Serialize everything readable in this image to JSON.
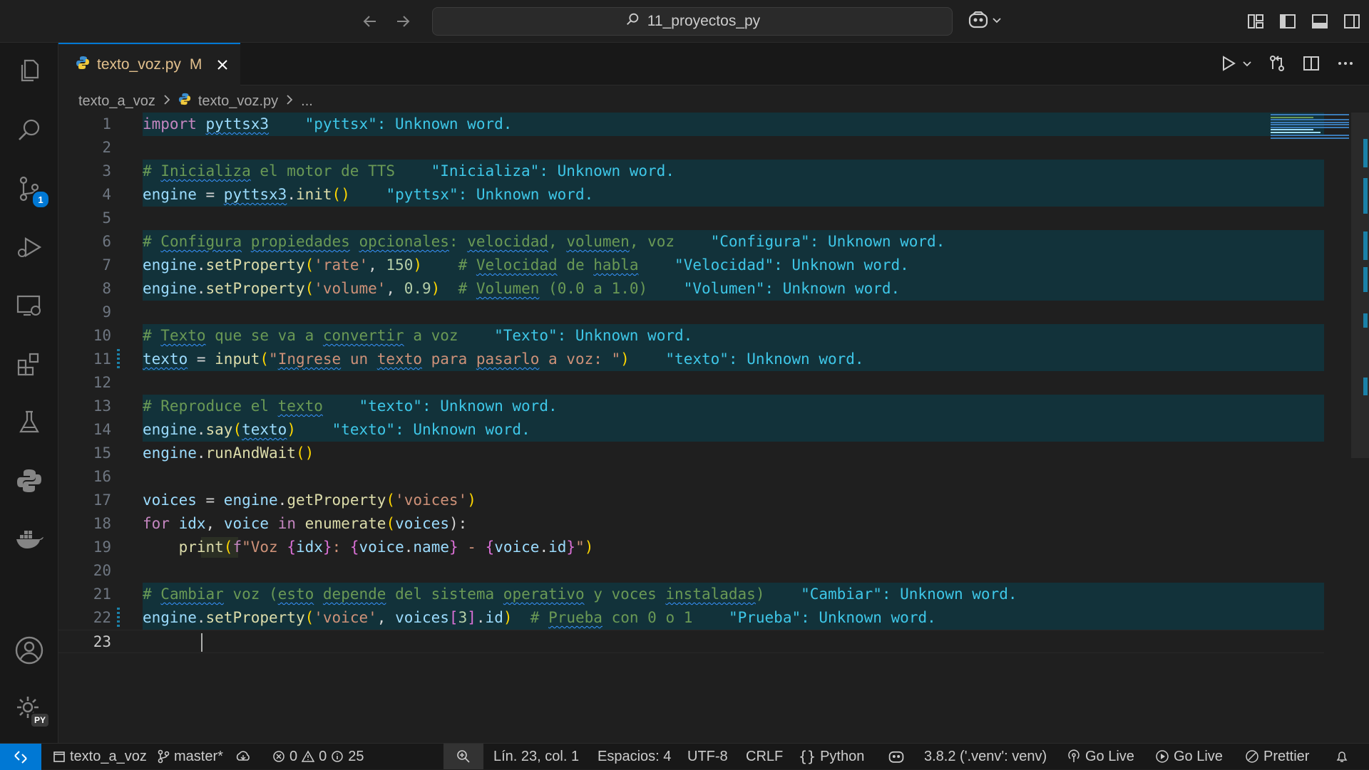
{
  "titlebar": {
    "search_text": "11_proyectos_py"
  },
  "tab": {
    "filename": "texto_voz.py",
    "modified": "M"
  },
  "breadcrumb": {
    "folder": "texto_a_voz",
    "file": "texto_voz.py",
    "more": "..."
  },
  "activity_bar": {
    "scm_badge": "1",
    "account_badge": "PY"
  },
  "status_bar": {
    "folder": "texto_a_voz",
    "branch": "master*",
    "errors": "0",
    "warnings": "0",
    "infos": "25",
    "position": "Lín. 23, col. 1",
    "spaces": "Espacios: 4",
    "encoding": "UTF-8",
    "eol": "CRLF",
    "language": "Python",
    "interpreter": "3.8.2 ('.venv': venv)",
    "go_live_1": "Go Live",
    "go_live_2": "Go Live",
    "prettier": "Prettier"
  },
  "editor": {
    "active_line": "23",
    "line_numbers": [
      "1",
      "2",
      "3",
      "4",
      "5",
      "6",
      "7",
      "8",
      "9",
      "10",
      "11",
      "12",
      "13",
      "14",
      "15",
      "16",
      "17",
      "18",
      "19",
      "20",
      "21",
      "22",
      "23"
    ],
    "tokens": {
      "l1": [
        "import",
        "pyttsx3"
      ],
      "d1": "\"pyttsx\": Unknown word.",
      "l3": [
        "# ",
        "Inicializa",
        " el motor de TTS"
      ],
      "d3": "\"Inicializa\": Unknown word.",
      "l4": [
        "engine",
        " = ",
        "pyttsx3",
        ".",
        "init",
        "(",
        ")"
      ],
      "d4": "\"pyttsx\": Unknown word.",
      "l6": [
        "# ",
        "Configura",
        " ",
        "propiedades",
        " ",
        "opcionales",
        ": ",
        "velocidad",
        ", ",
        "volumen",
        ", voz"
      ],
      "d6": "\"Configura\": Unknown word.",
      "l7": [
        "engine",
        ".",
        "setProperty",
        "(",
        "'rate'",
        ", ",
        "150",
        ")",
        "    ",
        "# ",
        "Velocidad",
        " de ",
        "habla"
      ],
      "d7": "\"Velocidad\": Unknown word.",
      "l8": [
        "engine",
        ".",
        "setProperty",
        "(",
        "'volume'",
        ", ",
        "0.9",
        ")",
        "  ",
        "# ",
        "Volumen",
        " (0.0 a 1.0)"
      ],
      "d8": "\"Volumen\": Unknown word.",
      "l10": [
        "# ",
        "Texto",
        " que se va a ",
        "convertir",
        " a voz"
      ],
      "d10": "\"Texto\": Unknown word.",
      "l11": [
        "texto",
        " = ",
        "input",
        "(",
        "\"",
        "Ingrese",
        " un ",
        "texto",
        " para ",
        "pasarlo",
        " a voz: \"",
        ")"
      ],
      "d11": "\"texto\": Unknown word.",
      "l13": [
        "# Reproduce el ",
        "texto"
      ],
      "d13": "\"texto\": Unknown word.",
      "l14": [
        "engine",
        ".",
        "say",
        "(",
        "texto",
        ")"
      ],
      "d14": "\"texto\": Unknown word.",
      "l15": [
        "engine",
        ".",
        "runAndWait",
        "(",
        ")"
      ],
      "l17": [
        "voices",
        " = ",
        "engine",
        ".",
        "getProperty",
        "(",
        "'voices'",
        ")"
      ],
      "l18": [
        "for",
        " ",
        "idx",
        ", ",
        "voice",
        " ",
        "in",
        " ",
        "enumerate",
        "(",
        "voices",
        "):"
      ],
      "l19": [
        "print",
        "(",
        "f",
        "\"Voz ",
        "{",
        "idx",
        "}",
        ": ",
        "{",
        "voice",
        ".",
        "name",
        "}",
        " - ",
        "{",
        "voice",
        ".",
        "id",
        "}",
        "\"",
        ")"
      ],
      "l21": [
        "# ",
        "Cambiar",
        " voz (",
        "esto",
        " ",
        "depende",
        " del sistema ",
        "operativo",
        " y voces ",
        "instaladas",
        ")"
      ],
      "d21": "\"Cambiar\": Unknown word.",
      "l22": [
        "engine",
        ".",
        "setProperty",
        "(",
        "'voice'",
        ", ",
        "voices",
        "[",
        "3",
        "]",
        ".",
        "id",
        ")",
        "  ",
        "# ",
        "Prueba",
        " con 0 o 1"
      ],
      "d22": "\"Prueba\": Unknown word."
    }
  },
  "colors": {
    "accent": "#0078d4",
    "keyword": "#c586c0",
    "comment": "#6a9955",
    "string": "#ce9178",
    "number": "#b5cea8",
    "function": "#dcdcaa",
    "variable": "#9cdcfe",
    "diagnostic": "#3ec7e8",
    "modified": "#e2c08d"
  }
}
